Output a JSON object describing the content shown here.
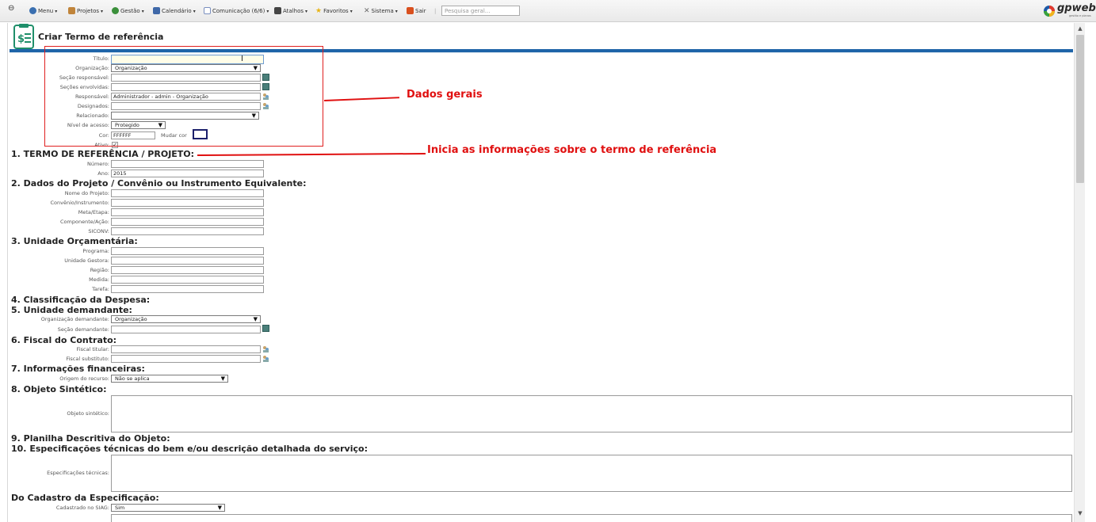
{
  "menu": {
    "items": [
      {
        "label": "Menu",
        "icon": "globe-icon",
        "color": "#3a6fb0"
      },
      {
        "label": "Projetos",
        "icon": "projects-icon",
        "color": "#c0843a"
      },
      {
        "label": "Gestão",
        "icon": "gestao-icon",
        "color": "#3a8f3a"
      },
      {
        "label": "Calendário",
        "icon": "calendar-icon",
        "color": "#3f68a8"
      },
      {
        "label": "Comunicação (6/6)",
        "icon": "mail-icon",
        "color": "#7a8fbf"
      },
      {
        "label": "Atalhos",
        "icon": "shortcut-icon",
        "color": "#444444"
      },
      {
        "label": "Favoritos",
        "icon": "star-icon",
        "color": "#e7b416"
      },
      {
        "label": "Sistema",
        "icon": "tools-icon",
        "color": "#6a6a6a"
      },
      {
        "label": "Sair",
        "icon": "exit-icon",
        "color": "#d9501e"
      }
    ],
    "search_placeholder": "Pesquisa geral...",
    "logo_text": "gpweb",
    "logo_sub": "gestão e planos"
  },
  "page": {
    "title": "Criar Termo de referência"
  },
  "general": {
    "titulo_label": "Título:",
    "organizacao_label": "Organização:",
    "organizacao_value": "Organização",
    "secao_resp_label": "Seção responsável:",
    "secoes_env_label": "Seções envolvidas:",
    "responsavel_label": "Responsável:",
    "responsavel_value": "Administrador - admin - Organização",
    "designados_label": "Designados:",
    "relacionado_label": "Relacionado:",
    "nivel_label": "Nível de acesso:",
    "nivel_value": "Protegido",
    "cor_label": "Cor:",
    "cor_value": "FFFFFF",
    "mudar_cor_label": "Mudar cor",
    "ativo_label": "Ativo:"
  },
  "s1": {
    "heading": "1. TERMO DE REFERÊNCIA / PROJETO:",
    "numero_label": "Número:",
    "ano_label": "Ano:",
    "ano_value": "2015"
  },
  "s2": {
    "heading": "2. Dados do Projeto / Convênio ou Instrumento Equivalente:",
    "nome_label": "Nome do Projeto:",
    "convenio_label": "Convênio/Instrumento:",
    "meta_label": "Meta/Etapa:",
    "componente_label": "Componente/Ação:",
    "siconv_label": "SICONV:"
  },
  "s3": {
    "heading": "3. Unidade Orçamentária:",
    "programa_label": "Programa:",
    "unidade_gestora_label": "Unidade Gestora:",
    "regiao_label": "Região:",
    "medida_label": "Medida:",
    "tarefa_label": "Tarefa:"
  },
  "s4": {
    "heading": "4. Classificação da Despesa:"
  },
  "s5": {
    "heading": "5. Unidade demandante:",
    "org_label": "Organização demandante:",
    "org_value": "Organização",
    "secao_label": "Seção demandante:"
  },
  "s6": {
    "heading": "6. Fiscal do Contrato:",
    "titular_label": "Fiscal titular:",
    "substituto_label": "Fiscal substituto:"
  },
  "s7": {
    "heading": "7. Informações financeiras:",
    "origem_label": "Origem do recurso:",
    "origem_value": "Não se aplica"
  },
  "s8": {
    "heading": "8. Objeto Sintético:",
    "objeto_label": "Objeto sintético:"
  },
  "s9": {
    "heading": "9. Planilha Descritiva do Objeto:"
  },
  "s10": {
    "heading": "10. Especificações técnicas do bem e/ou descrição detalhada do serviço:",
    "espec_label": "Especificações técnicas:"
  },
  "cadastro": {
    "heading": "Do Cadastro da Especificação:",
    "siag_label": "Cadastrado no SIAG:",
    "siag_value": "Sim"
  },
  "annotations": {
    "dados_gerais": "Dados gerais",
    "inicia": "Inicia as informações sobre o termo de referência"
  }
}
